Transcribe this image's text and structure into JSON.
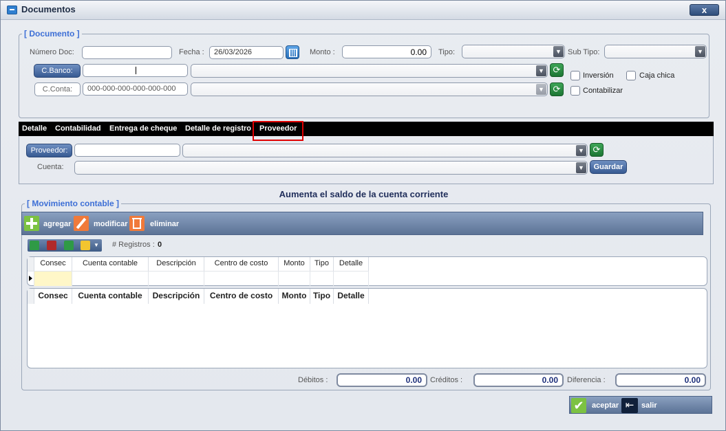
{
  "window": {
    "title": "Documentos",
    "close_label": "x"
  },
  "documento": {
    "legend": "[ Documento ]",
    "numero_doc_label": "Número Doc:",
    "numero_doc_value": "",
    "fecha_label": "Fecha :",
    "fecha_value": "26/03/2026",
    "monto_label": "Monto :",
    "monto_value": "0.00",
    "tipo_label": "Tipo:",
    "tipo_value": "",
    "subtipo_label": "Sub Tipo:",
    "subtipo_value": "",
    "cbanco_button": "C.Banco:",
    "cbanco_code": "",
    "cbanco_name": "",
    "cconta_button": "C.Conta:",
    "cconta_code": "000-000-000-000-000-000",
    "cconta_name": "",
    "inversion_label": "Inversión",
    "caja_chica_label": "Caja chica",
    "contabilizar_label": "Contabilizar"
  },
  "tabs": [
    "Detalle",
    "Contabilidad",
    "Entrega de cheque",
    "Detalle de registro",
    "Proveedor"
  ],
  "proveedor": {
    "button": "Proveedor:",
    "code": "",
    "name": "",
    "cuenta_label": "Cuenta:",
    "cuenta_value": "",
    "guardar_label": "Guardar"
  },
  "info_message": "Aumenta el saldo de la cuenta corriente",
  "movimiento": {
    "legend": "[ Movimiento contable ]",
    "agregar": "agregar",
    "modificar": "modificar",
    "eliminar": "eliminar",
    "registros_label": "# Registros :",
    "registros_count": "0",
    "columns": [
      "Consec",
      "Cuenta contable",
      "Descripción",
      "Centro de costo",
      "Monto",
      "Tipo",
      "Detalle"
    ]
  },
  "totals": {
    "debitos_label": "Débitos :",
    "debitos_value": "0.00",
    "creditos_label": "Créditos :",
    "creditos_value": "0.00",
    "diferencia_label": "Diferencia :",
    "diferencia_value": "0.00"
  },
  "actions": {
    "aceptar": "aceptar",
    "salir": "salir"
  },
  "colors": {
    "accent": "#3d6fd6",
    "tab_bar": "#000000",
    "highlight": "#e00000",
    "total_text": "#1d2f7a"
  }
}
